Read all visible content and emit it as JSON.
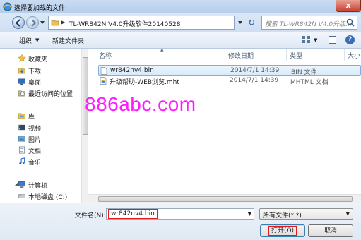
{
  "window": {
    "title": "选择要加载的文件",
    "close_label": "x"
  },
  "nav": {
    "address": "TL-WR842N V4.0升级软件20140528",
    "search_placeholder": "搜索 TL-WR842N V4.0升级...",
    "refresh_glyph": "↻"
  },
  "toolbar": {
    "organize": "组织",
    "new_folder": "新建文件夹"
  },
  "sidebar": {
    "favorites": "收藏夹",
    "favorites_items": [
      "下载",
      "桌面",
      "最近访问的位置"
    ],
    "library": "库",
    "library_items": [
      "视频",
      "图片",
      "文档",
      "音乐"
    ],
    "computer": "计算机",
    "computer_items": [
      "本地磁盘 (C:)"
    ]
  },
  "columns": {
    "name": "名称",
    "date": "修改日期",
    "type": "类型",
    "size": "大小"
  },
  "files": [
    {
      "name": "wr842nv4.bin",
      "date": "2014/7/1 14:39",
      "type": "BIN 文件",
      "selected": true
    },
    {
      "name": "升级帮助-WEB浏览.mht",
      "date": "2014/7/1 14:39",
      "type": "MHTML 文档",
      "selected": false
    }
  ],
  "watermark": "886abc.com",
  "bottom": {
    "filename_label": "文件名(N):",
    "filename_value": "wr842nv4.bin",
    "filter": "所有文件(*.*)",
    "open": "打开(O)",
    "cancel": "取消"
  },
  "colors": {
    "accent_red": "#e21b1b",
    "watermark": "#ff1aff",
    "selection": "#d8ebfb"
  }
}
